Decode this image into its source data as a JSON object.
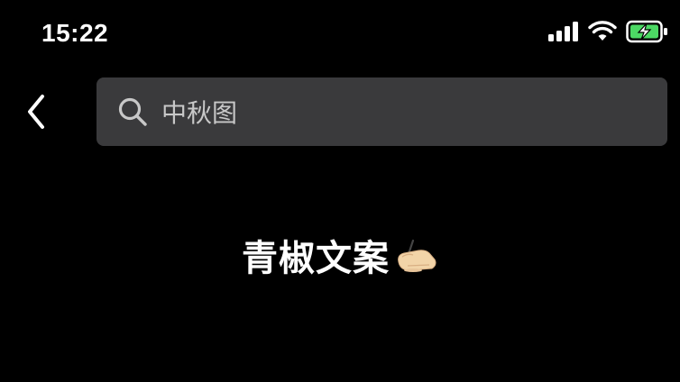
{
  "status_bar": {
    "time": "15:22",
    "signal_icon": "signal-bars-icon",
    "wifi_icon": "wifi-icon",
    "battery_icon": "battery-charging-icon",
    "battery_color": "#4cd964"
  },
  "nav": {
    "back_icon": "chevron-left-icon",
    "search": {
      "icon": "search-icon",
      "query": "中秋图"
    }
  },
  "content": {
    "title": "青椒文案",
    "title_emoji_icon": "writing-hand-icon"
  },
  "colors": {
    "background": "#000000",
    "search_bg": "#3a3a3c",
    "text": "#ffffff"
  }
}
